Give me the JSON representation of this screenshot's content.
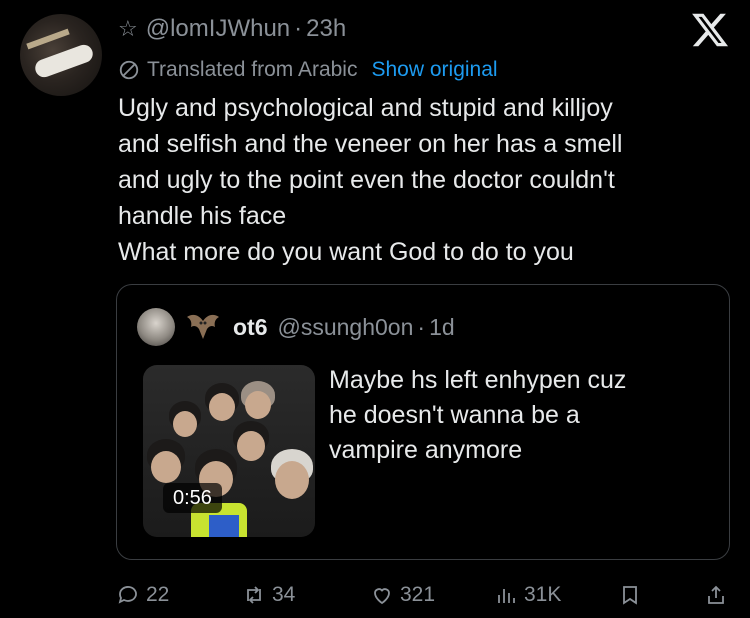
{
  "tweet": {
    "star": "☆",
    "handle": "@lomIJWhun",
    "separator": "·",
    "time": "23h",
    "translated_label": "Translated from Arabic",
    "show_original": "Show original",
    "lines": [
      "Ugly and psychological and stupid and killjoy",
      "and selfish and the veneer on her has a smell",
      "and ugly to the point even the doctor couldn't",
      "handle his face",
      "What more do you want God to do to you"
    ]
  },
  "quote": {
    "name": "ot6",
    "handle": "@ssungh0on",
    "separator": "·",
    "time": "1d",
    "video_duration": "0:56",
    "lines": [
      "Maybe hs left enhypen cuz",
      "he doesn't wanna be a",
      "vampire anymore"
    ]
  },
  "actions": {
    "replies": "22",
    "retweets": "34",
    "likes": "321",
    "views": "31K"
  },
  "colors": {
    "background": "#000000",
    "text": "#e7e9ea",
    "muted": "#8b9198",
    "link": "#1d9bf0"
  }
}
